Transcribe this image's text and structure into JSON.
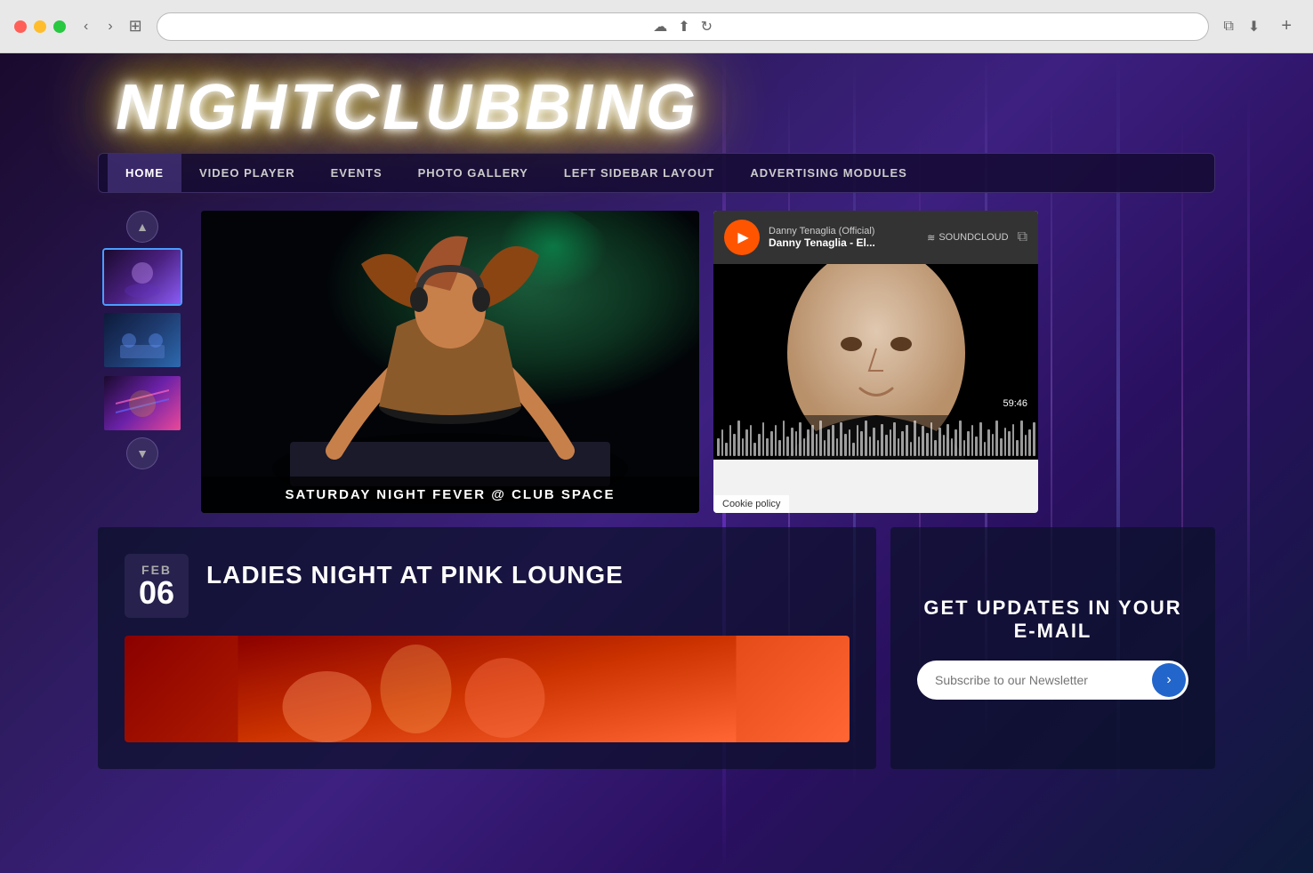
{
  "browser": {
    "dots": [
      "red",
      "yellow",
      "green"
    ],
    "back_label": "‹",
    "forward_label": "›",
    "sidebar_label": "⊞",
    "cloud_icon": "☁",
    "share_icon": "⬆",
    "reload_icon": "↻",
    "duplicate_icon": "⧉",
    "download_icon": "⬇",
    "add_tab_label": "+"
  },
  "site": {
    "logo": "NIGHTCLUBBING",
    "nav_items": [
      {
        "label": "HOME",
        "active": true
      },
      {
        "label": "VIDEO PLAYER",
        "active": false
      },
      {
        "label": "EVENTS",
        "active": false
      },
      {
        "label": "PHOTO GALLERY",
        "active": false
      },
      {
        "label": "LEFT SIDEBAR LAYOUT",
        "active": false
      },
      {
        "label": "ADVERTISING MODULES",
        "active": false
      }
    ]
  },
  "gallery": {
    "up_arrow": "▲",
    "down_arrow": "▼",
    "thumbs": [
      {
        "id": 1,
        "active": true
      },
      {
        "id": 2,
        "active": false
      },
      {
        "id": 3,
        "active": false
      }
    ]
  },
  "main_image": {
    "caption": "SATURDAY NIGHT FEVER @ CLUB SPACE"
  },
  "soundcloud": {
    "artist": "Danny Tenaglia (Official)",
    "track": "Danny Tenaglia - El...",
    "logo_text": "SOUNDCLOUD",
    "logo_icon": "≋",
    "time": "59:46",
    "cookie_text": "Cookie policy"
  },
  "event": {
    "month": "FEB",
    "day": "06",
    "title": "LADIES NIGHT AT PINK LOUNGE"
  },
  "newsletter": {
    "title": "GET UPDATES IN YOUR E-MAIL",
    "input_placeholder": "Subscribe to our Newsletter",
    "submit_arrow": "›"
  }
}
